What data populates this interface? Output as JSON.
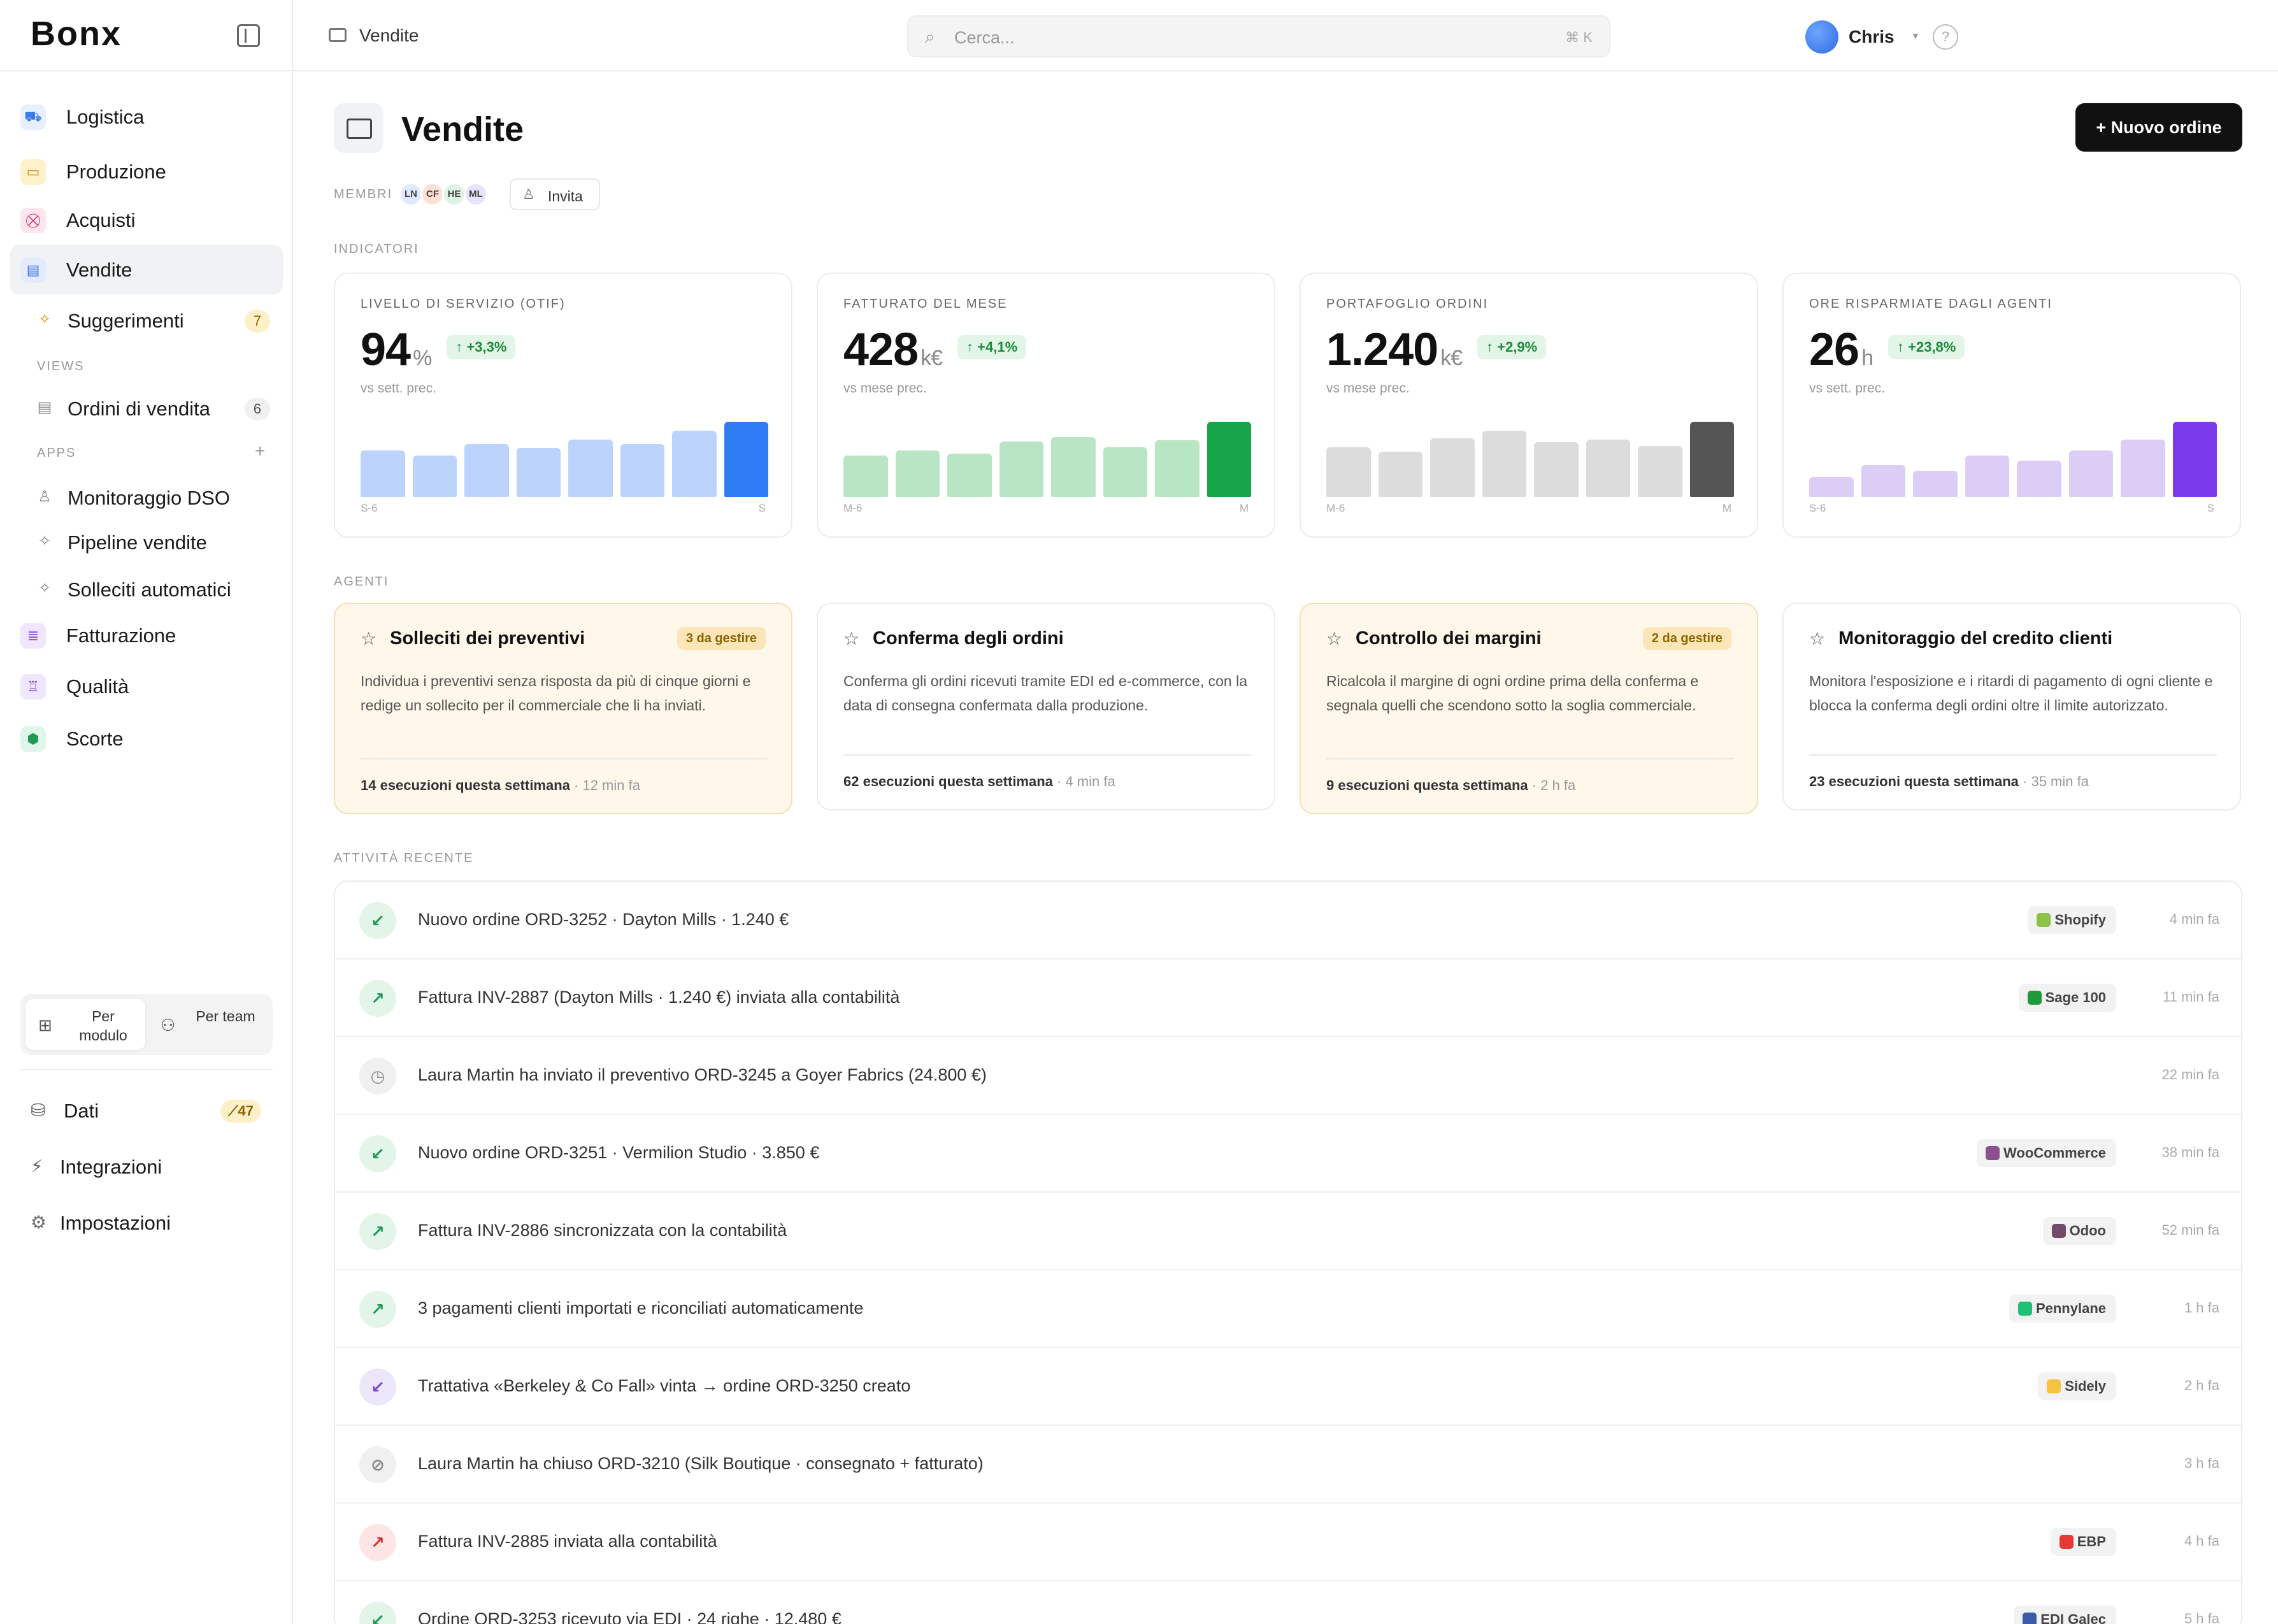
{
  "sidebar": {
    "logo": "Bonx",
    "items": [
      {
        "label": "Logistica",
        "icon": "truck-icon",
        "color": "#e7f0ff",
        "fg": "#3b7be8",
        "glyph": "⛟"
      },
      {
        "label": "Produzione",
        "icon": "folder-icon",
        "color": "#fff1cc",
        "fg": "#c98a00",
        "glyph": "▭"
      },
      {
        "label": "Acquisti",
        "icon": "cart-icon",
        "color": "#ffe6ee",
        "fg": "#d6336c",
        "glyph": "⛒"
      },
      {
        "label": "Vendite",
        "icon": "card-icon",
        "color": "#e3ecff",
        "fg": "#3b6fe0",
        "glyph": "▤"
      }
    ],
    "sub_items": {
      "suggestions": {
        "label": "Suggerimenti",
        "count": "7"
      },
      "views_label": "VIEWS",
      "sales_orders": {
        "label": "Ordini di vendita",
        "count": "6"
      },
      "apps_label": "APPS",
      "apps": [
        {
          "label": "Monitoraggio DSO",
          "icon": "user-icon",
          "glyph": "♙"
        },
        {
          "label": "Pipeline vendite",
          "icon": "sparkle-icon",
          "glyph": "✧"
        },
        {
          "label": "Solleciti automatici",
          "icon": "sparkle-icon",
          "glyph": "✧"
        }
      ]
    },
    "items_after": [
      {
        "label": "Fatturazione",
        "icon": "invoice-icon",
        "color": "#f0e6ff",
        "fg": "#8a4fd9",
        "glyph": "≣"
      },
      {
        "label": "Qualità",
        "icon": "award-icon",
        "color": "#efe6ff",
        "fg": "#7a48d0",
        "glyph": "♖"
      },
      {
        "label": "Scorte",
        "icon": "box-icon",
        "color": "#e1f6ea",
        "fg": "#1f9a57",
        "glyph": "⬢"
      }
    ],
    "toggle": {
      "by_module": "Per modulo",
      "by_team": "Per team"
    },
    "bottom": {
      "data": {
        "label": "Dati",
        "badge": "⟋47"
      },
      "integrations": {
        "label": "Integrazioni"
      },
      "settings": {
        "label": "Impostazioni"
      }
    }
  },
  "topbar": {
    "breadcrumb": "Vendite",
    "search_placeholder": "Cerca...",
    "search_shortcut": "⌘ K",
    "user": "Chris",
    "help": "?"
  },
  "header": {
    "title": "Vendite",
    "new_order": "+ Nuovo ordine",
    "members_label": "MEMBRI",
    "members": [
      {
        "initials": "LN",
        "bg": "#dfe9ff"
      },
      {
        "initials": "CF",
        "bg": "#ffe0d6"
      },
      {
        "initials": "HE",
        "bg": "#dff3e4"
      },
      {
        "initials": "ML",
        "bg": "#e9e2ff"
      }
    ],
    "invite": "Invita"
  },
  "indicators": {
    "label": "INDICATORI",
    "cards": [
      {
        "title": "LIVELLO DI SERVIZIO (OTIF)",
        "value": "94",
        "unit": "%",
        "delta": "↑ +3,3%",
        "sub": "vs sett. prec.",
        "axis_start": "S-6",
        "axis_end": "S",
        "bar_color": "#bcd4fb",
        "bar_active": "#2f7bf6",
        "values": [
          0.62,
          0.55,
          0.7,
          0.65,
          0.76,
          0.7,
          0.88,
          1.0
        ]
      },
      {
        "title": "FATTURATO DEL MESE",
        "value": "428",
        "unit": "k€",
        "delta": "↑ +4,1%",
        "sub": "vs mese prec.",
        "axis_start": "M-6",
        "axis_end": "M",
        "bar_color": "#b8e6c5",
        "bar_active": "#16a34a",
        "values": [
          0.55,
          0.62,
          0.58,
          0.74,
          0.8,
          0.66,
          0.75,
          1.0
        ]
      },
      {
        "title": "PORTAFOGLIO ORDINI",
        "value": "1.240",
        "unit": "k€",
        "delta": "↑ +2,9%",
        "sub": "vs mese prec.",
        "axis_start": "M-6",
        "axis_end": "M",
        "bar_color": "#dcdcdc",
        "bar_active": "#555555",
        "values": [
          0.66,
          0.6,
          0.78,
          0.88,
          0.73,
          0.76,
          0.68,
          1.0
        ]
      },
      {
        "title": "ORE RISPARMIATE DAGLI AGENTI",
        "value": "26",
        "unit": "h",
        "delta": "↑ +23,8%",
        "sub": "vs sett. prec.",
        "axis_start": "S-6",
        "axis_end": "S",
        "bar_color": "#dccdf7",
        "bar_active": "#7c3aed",
        "values": [
          0.26,
          0.42,
          0.35,
          0.55,
          0.48,
          0.62,
          0.76,
          1.0
        ]
      }
    ]
  },
  "agents": {
    "label": "AGENTI",
    "cards": [
      {
        "title": "Solleciti dei preventivi",
        "badge": "3 da gestire",
        "warn": true,
        "desc": "Individua i preventivi senza risposta da più di cinque giorni e redige un sollecito per il commerciale che li ha inviati.",
        "runs": "14 esecuzioni questa settimana",
        "ago": " · 12 min fa"
      },
      {
        "title": "Conferma degli ordini",
        "badge": "",
        "warn": false,
        "desc": "Conferma gli ordini ricevuti tramite EDI ed e-commerce, con la data di consegna confermata dalla produzione.",
        "runs": "62 esecuzioni questa settimana",
        "ago": " · 4 min fa"
      },
      {
        "title": "Controllo dei margini",
        "badge": "2 da gestire",
        "warn": true,
        "desc": "Ricalcola il margine di ogni ordine prima della conferma e segnala quelli che scendono sotto la soglia commerciale.",
        "runs": "9 esecuzioni questa settimana",
        "ago": " · 2 h fa"
      },
      {
        "title": "Monitoraggio del credito clienti",
        "badge": "",
        "warn": false,
        "desc": "Monitora l'esposizione e i ritardi di pagamento di ogni cliente e blocca la conferma degli ordini oltre il limite autorizzato.",
        "runs": "23 esecuzioni questa settimana",
        "ago": " · 35 min fa"
      }
    ]
  },
  "activity": {
    "label": "ATTIVITÀ RECENTE",
    "rows": [
      {
        "text": "Nuovo ordine ORD-3252 · Dayton Mills · 1.240 €",
        "source": "Shopify",
        "src_color": "#8bc34a",
        "time": "4 min fa",
        "glyph": "↙",
        "ibg": "#e3f5e8",
        "ifg": "#1f9a57"
      },
      {
        "text": "Fattura INV-2887 (Dayton Mills · 1.240 €) inviata alla contabilità",
        "source": "Sage 100",
        "src_color": "#1f9a3a",
        "time": "11 min fa",
        "glyph": "↗",
        "ibg": "#e3f5e8",
        "ifg": "#1f9a57"
      },
      {
        "text": "Laura Martin ha inviato il preventivo ORD-3245 a Goyer Fabrics (24.800 €)",
        "source": "",
        "src_color": "",
        "time": "22 min fa",
        "glyph": "◷",
        "ibg": "#f0f0f1",
        "ifg": "#888888"
      },
      {
        "text": "Nuovo ordine ORD-3251 · Vermilion Studio · 3.850 €",
        "source": "WooCommerce",
        "src_color": "#8a4f8f",
        "time": "38 min fa",
        "glyph": "↙",
        "ibg": "#e3f5e8",
        "ifg": "#1f9a57"
      },
      {
        "text": "Fattura INV-2886 sincronizzata con la contabilità",
        "source": "Odoo",
        "src_color": "#714b67",
        "time": "52 min fa",
        "glyph": "↗",
        "ibg": "#e3f5e8",
        "ifg": "#1f9a57"
      },
      {
        "text": "3 pagamenti clienti importati e riconciliati automaticamente",
        "source": "Pennylane",
        "src_color": "#1fbf75",
        "time": "1 h fa",
        "glyph": "↗",
        "ibg": "#e3f5e8",
        "ifg": "#1f9a57"
      },
      {
        "text": "Trattativa «Berkeley & Co Fall» vinta → ordine ORD-3250 creato",
        "source": "Sidely",
        "src_color": "#f5c342",
        "time": "2 h fa",
        "glyph": "↙",
        "ibg": "#ece6fb",
        "ifg": "#7a48d0"
      },
      {
        "text": "Laura Martin ha chiuso ORD-3210 (Silk Boutique · consegnato + fatturato)",
        "source": "",
        "src_color": "",
        "time": "3 h fa",
        "glyph": "⊘",
        "ibg": "#f0f0f1",
        "ifg": "#888888"
      },
      {
        "text": "Fattura INV-2885 inviata alla contabilità",
        "source": "EBP",
        "src_color": "#e53935",
        "time": "4 h fa",
        "glyph": "↗",
        "ibg": "#fde5e5",
        "ifg": "#d93030"
      },
      {
        "text": "Ordine ORD-3253 ricevuto via EDI · 24 righe · 12.480 €",
        "source": "EDI Galec",
        "src_color": "#3a5ba8",
        "time": "5 h fa",
        "glyph": "↙",
        "ibg": "#e3f5e8",
        "ifg": "#1f9a57"
      }
    ]
  }
}
